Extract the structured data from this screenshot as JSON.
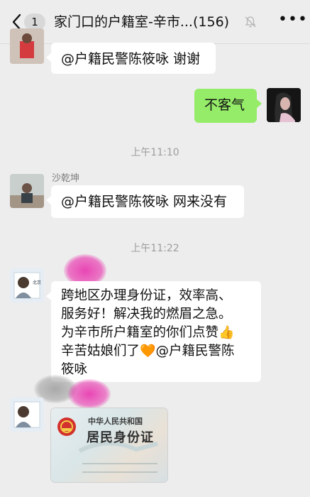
{
  "header": {
    "badge": "1",
    "title": "家门口的户籍室-辛市...(156)"
  },
  "messages": [
    {
      "text": "@户籍民警陈筱咏 谢谢"
    },
    {
      "text": "不客气"
    },
    {
      "sender": "沙乾坤",
      "text": "@户籍民警陈筱咏 网来没有"
    },
    {
      "lines": [
        "跨地区办理身份证，效率高、",
        "服务好！解决我的燃眉之急。",
        "为辛市所户籍室的你们点赞",
        "辛苦姑娘们了",
        "@户籍民警陈",
        "筱咏"
      ],
      "emoji_thumb": "👍",
      "emoji_heart": "🧡"
    }
  ],
  "timestamps": [
    "上午11:10",
    "上午11:22"
  ],
  "idcard": {
    "title1": "中华人民共和国",
    "title2": "居民身份证"
  },
  "icons": [
    "back-arrow",
    "mute-bell",
    "more-dots"
  ],
  "colors": {
    "background": "#ededed",
    "bubble_self": "#95ec69",
    "bubble_other": "#ffffff"
  }
}
